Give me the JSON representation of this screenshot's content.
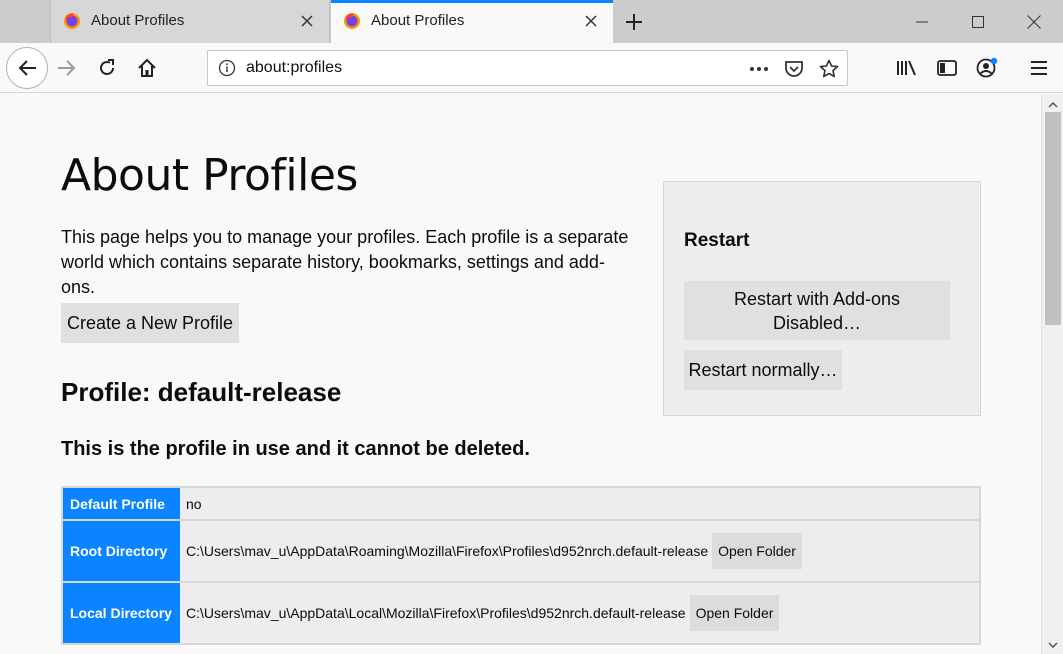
{
  "browser": {
    "tabs": [
      {
        "title": "About Profiles",
        "active": false
      },
      {
        "title": "About Profiles",
        "active": true
      }
    ],
    "url": "about:profiles",
    "accent_color": "#0a84ff"
  },
  "page": {
    "title": "About Profiles",
    "intro": "This page helps you to manage your profiles. Each profile is a separate world which contains separate history, bookmarks, settings and add-ons.",
    "create_button": "Create a New Profile",
    "restart": {
      "heading": "Restart",
      "addons_disabled_button": "Restart with Add-ons Disabled…",
      "normal_button": "Restart normally…"
    },
    "profile": {
      "heading": "Profile: default-release",
      "in_use_note": "This is the profile in use and it cannot be deleted.",
      "rows": [
        {
          "label": "Default Profile",
          "value": "no"
        },
        {
          "label": "Root Directory",
          "value": "C:\\Users\\mav_u\\AppData\\Roaming\\Mozilla\\Firefox\\Profiles\\d952nrch.default-release",
          "button": "Open Folder"
        },
        {
          "label": "Local Directory",
          "value": "C:\\Users\\mav_u\\AppData\\Local\\Mozilla\\Firefox\\Profiles\\d952nrch.default-release",
          "button": "Open Folder"
        }
      ]
    }
  }
}
